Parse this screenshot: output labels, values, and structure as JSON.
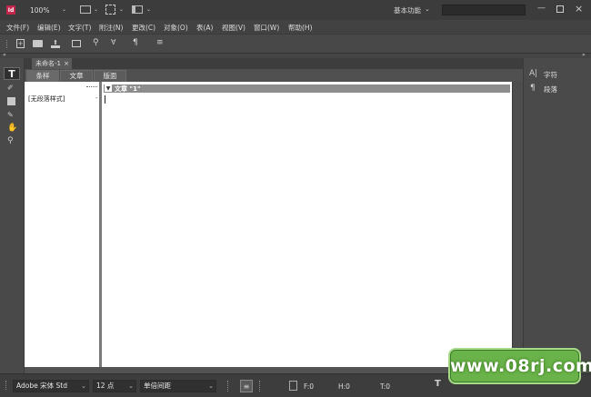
{
  "titlebar": {
    "app_icon": "indesign-logo-icon",
    "zoom": "100%",
    "workspace": "基本功能",
    "search_placeholder": ""
  },
  "menu": [
    {
      "label": "文件(F)"
    },
    {
      "label": "编辑(E)"
    },
    {
      "label": "文字(T)"
    },
    {
      "label": "附注(N)"
    },
    {
      "label": "更改(C)"
    },
    {
      "label": "对象(O)"
    },
    {
      "label": "表(A)"
    },
    {
      "label": "视图(V)"
    },
    {
      "label": "窗口(W)"
    },
    {
      "label": "帮助(H)"
    }
  ],
  "document": {
    "tab_label": "未命名-1",
    "view_tabs": [
      "条样",
      "文章",
      "版面"
    ],
    "style_column_item": "[无段落样式]",
    "story_header": "文章 \"1\""
  },
  "right_panel": {
    "items": [
      {
        "label": "字符",
        "icon": "character-icon"
      },
      {
        "label": "段落",
        "icon": "paragraph-icon"
      }
    ]
  },
  "statusbar": {
    "font": "Adobe 宋体 Std",
    "size": "12 点",
    "spacing": "单倍间距",
    "f": "F:0",
    "h": "H:0",
    "t": "T:0"
  },
  "watermark": {
    "text": "www.08rj.com"
  }
}
